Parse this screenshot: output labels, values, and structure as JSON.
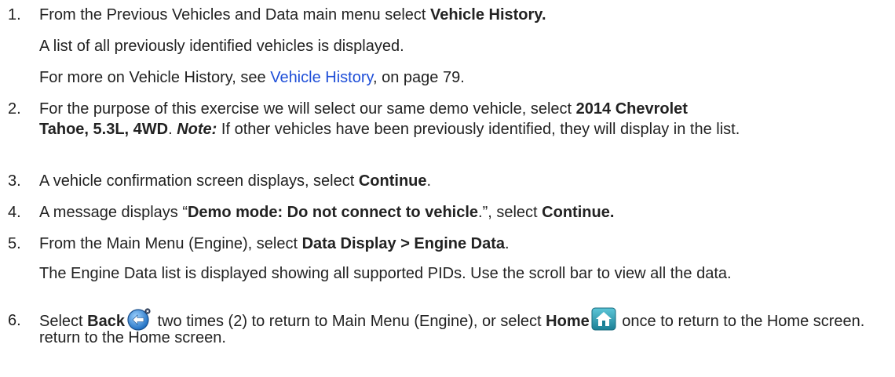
{
  "steps": [
    {
      "num": "1.",
      "prefix": "From the Previous Vehicles and Data main menu select ",
      "bold": "Vehicle History.",
      "line2": "A list of all previously identified vehicles is displayed.",
      "line3_prefix": "For more on Vehicle History, see ",
      "line3_link": "Vehicle History",
      "line3_suffix": ", on page 79."
    },
    {
      "num": "2.",
      "prefix": "For the purpose of this exercise we will select our same demo vehicle, select ",
      "bold1": "2014 Chevrolet",
      "bold2": "Tahoe, 5.3L, 4WD",
      "after_bold2": ". ",
      "note_label": "Note:",
      "note_text": " If other vehicles have been previously identified, they will display in the list."
    },
    {
      "num": "3.",
      "prefix": "A vehicle confirmation screen displays, select ",
      "bold": "Continue",
      "suffix": "."
    },
    {
      "num": "4.",
      "prefix": "A message displays “",
      "bold1": "Demo mode: Do not connect to vehicle",
      "mid": ".”, select ",
      "bold2": "Continue."
    },
    {
      "num": "5.",
      "prefix": "From the Main Menu (Engine), select ",
      "bold": "Data Display > Engine Data",
      "suffix": ".",
      "para": "The Engine Data list is displayed showing all supported PIDs. Use the scroll bar to view all the data."
    },
    {
      "num": "6.",
      "prefix": "Select ",
      "bold1": "Back",
      "mid": " two times (2) to return to Main Menu (Engine), or select ",
      "bold2": "Home",
      "suffix": " once to return to the Home screen."
    }
  ],
  "icons": {
    "back": "back-arrow-icon",
    "home": "home-icon",
    "back_color": "#2a7fd4",
    "home_color": "#2a9ab0"
  }
}
